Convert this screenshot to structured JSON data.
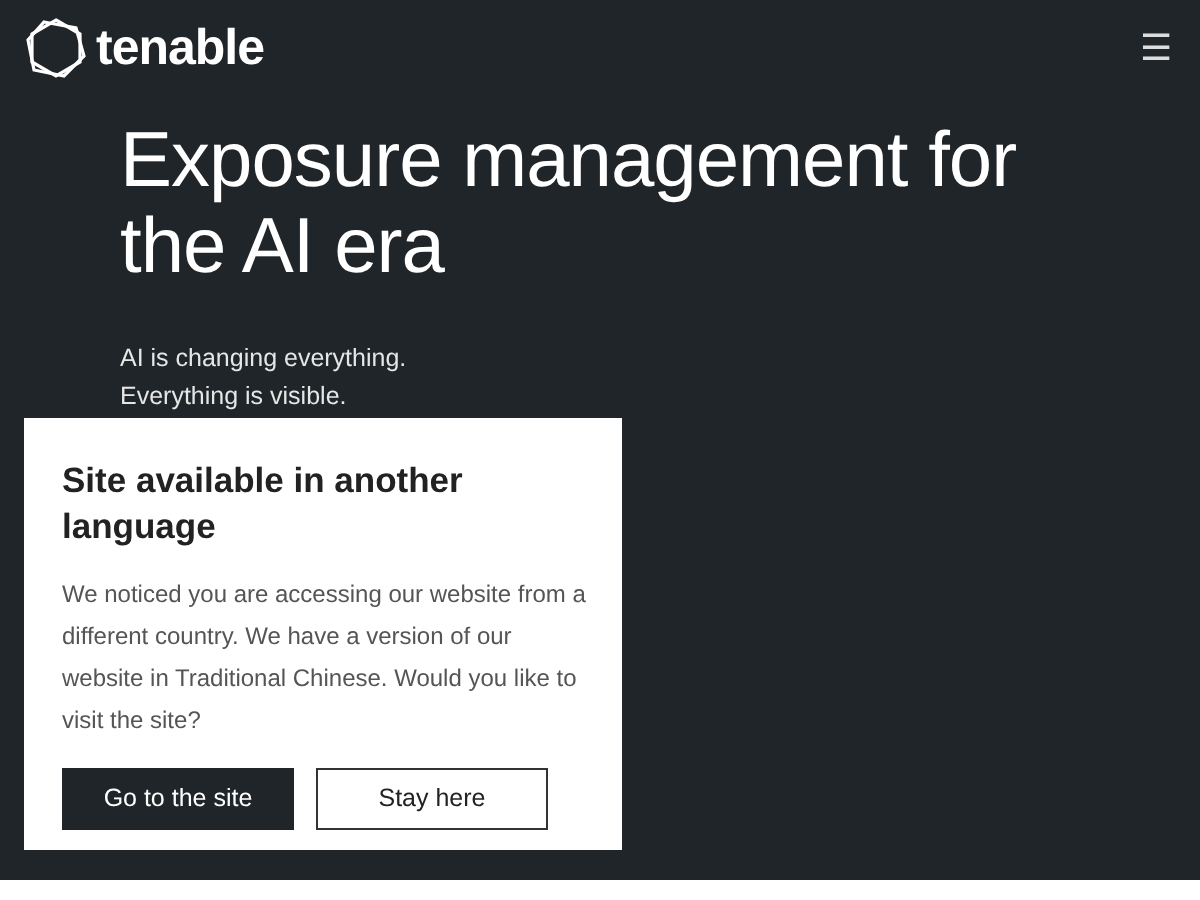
{
  "header": {
    "logo": "tenable",
    "menu_icon": "☰"
  },
  "hero": {
    "title": "Exposure management for the AI era",
    "lines": [
      "AI is changing everything.",
      "Everything is visible."
    ]
  },
  "dialog": {
    "title": "Site available in another language",
    "message": "We noticed you are accessing our website from a different country. We have a version of our website in Traditional Chinese. Would you like to visit the site?",
    "buttons": [
      {
        "label": "Go to the site",
        "kind": "primary"
      },
      {
        "label": "Stay here",
        "kind": "outline"
      }
    ]
  }
}
